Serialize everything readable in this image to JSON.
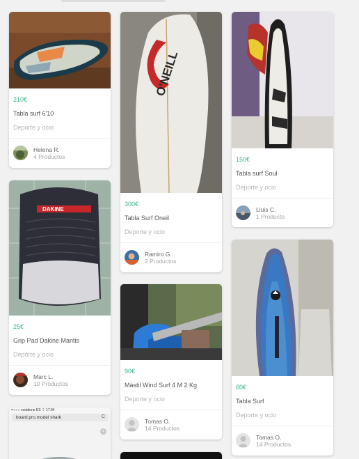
{
  "products": [
    {
      "price": "210€",
      "title": "Tabla surf 6'10",
      "category": "Deporte y ocio",
      "seller": "Helena R.",
      "count": "4 Productos"
    },
    {
      "price": "300€",
      "title": "Tabla Surf Oneil",
      "category": "Deporte y ocio",
      "seller": "Ramiro G.",
      "count": "2 Productos"
    },
    {
      "price": "150€",
      "title": "Tabla surf Soul",
      "category": "Deporte y ocio",
      "seller": "Lluis C.",
      "count": "1 Producto"
    },
    {
      "price": "25€",
      "title": "Grip Pad Dakine Mantis",
      "category": "Deporte y ocio",
      "seller": "Marc L.",
      "count": "10 Productos"
    },
    {
      "price": "90€",
      "title": "Mástil Wind Surf 4 M 2 Kg",
      "category": "Deporte y ocio",
      "seller": "Tomas O.",
      "count": "14 Productos"
    },
    {
      "price": "60€",
      "title": "Tabla Surf",
      "category": "Deporte y ocio",
      "seller": "Tomas O.",
      "count": "14 Productos"
    }
  ],
  "photo_text": {
    "oneill_brand": "O'NEILL",
    "dakine_brand": "DAKINE",
    "phone_status": "••○○○ vodafone ES  ⌔   17:04",
    "browser_url": "board.pro.model shark",
    "browser_reload": "C",
    "close_symbol": "×"
  },
  "colors": {
    "price": "#36b38a",
    "category": "#b6b6b6",
    "background": "#f1f1f1"
  }
}
